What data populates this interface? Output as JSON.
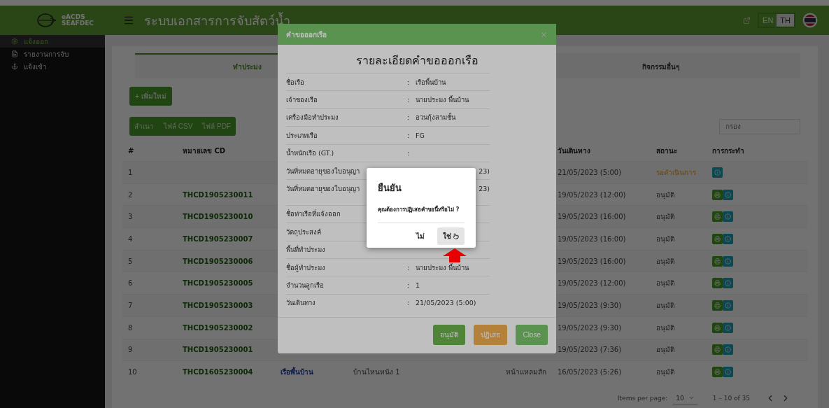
{
  "header": {
    "brand": [
      "eACDS",
      "SEAFDEC"
    ],
    "title": "ระบบเอกสารการจับสัตว์น้ำ",
    "languages": [
      {
        "label": "EN",
        "selected": false
      },
      {
        "label": "TH",
        "selected": true
      }
    ]
  },
  "sidebar": {
    "items": [
      {
        "label": "แจ้งออก",
        "kind": "gear",
        "selected": true
      },
      {
        "label": "รายงานการจับ",
        "kind": "file",
        "selected": false
      },
      {
        "label": "แจ้งเข้า",
        "kind": "anchor",
        "selected": false
      }
    ]
  },
  "tabs": [
    {
      "label": "ทำประมง",
      "selected": true
    },
    {
      "label": "กิจกรรมอื่นๆ",
      "selected": false
    }
  ],
  "add_button": "+ เพิ่มใหม่",
  "export_buttons": [
    "สำเนา",
    "ไฟล์ CSV",
    "ไฟล์ PDF"
  ],
  "filter": {
    "placeholder": "กรอง"
  },
  "table": {
    "columns": {
      "number": "#",
      "cd": "หมายเลข CD",
      "date": "วันเดินทาง",
      "status": "สถานะ",
      "actions": "การกระทำ"
    },
    "rows": [
      {
        "number": "1",
        "date": "21/05/2023 (5:00)",
        "status": "รอดำเนินการ",
        "pending": true,
        "printable": false
      },
      {
        "number": "2",
        "cd": "THCD1905230011",
        "date": "19/05/2023 (12:00)",
        "status": "อนุมัติ",
        "pending": false,
        "printable": true
      },
      {
        "number": "3",
        "cd": "THCD1905230010",
        "date": "19/05/2023 (16:00)",
        "status": "อนุมัติ",
        "pending": false,
        "printable": true
      },
      {
        "number": "4",
        "cd": "THCD1905230007",
        "date": "19/05/2023 (16:00)",
        "status": "อนุมัติ",
        "pending": false,
        "printable": true
      },
      {
        "number": "5",
        "cd": "THCD1905230006",
        "date": "19/05/2023 (16:00)",
        "status": "อนุมัติ",
        "pending": false,
        "printable": true
      },
      {
        "number": "6",
        "cd": "THCD1905230005",
        "date": "19/05/2023 (12:00)",
        "status": "อนุมัติ",
        "pending": false,
        "printable": true
      },
      {
        "number": "7",
        "cd": "THCD1905230003",
        "date": "19/05/2023 (9:30)",
        "status": "อนุมัติ",
        "pending": false,
        "printable": true
      },
      {
        "number": "8",
        "cd": "THCD1905230002",
        "date": "19/05/2023 (9:30)",
        "status": "อนุมัติ",
        "pending": false,
        "printable": true
      },
      {
        "number": "9",
        "cd": "THCD1905230001",
        "date": "19/05/2023 (7:36)",
        "status": "อนุมัติ",
        "pending": false,
        "printable": true
      },
      {
        "number": "10",
        "cd": "THCD1605230004",
        "column_3": "เรือพื้นบ้าน",
        "column_4": "บ้านไหนหนัง 1",
        "column_5": "หน้าแหลมสัก",
        "date": "16/05/2023 (5:26)",
        "status": "อนุมัติ",
        "pending": false,
        "printable": true
      }
    ]
  },
  "pagination": {
    "label": "Items per page:",
    "page_size": "10",
    "range": "1 – 10 of 35"
  },
  "modal": {
    "title": "คำขอออกเรือ",
    "heading": "รายละเอียดคำขอออกเรือ",
    "fields": [
      {
        "label": "ชื่อเรือ",
        "colon": ":",
        "value": "เรือพื้นบ้าน"
      },
      {
        "label": "เจ้าของเรือ",
        "colon": ":",
        "value": "นายประมง พื้นบ้าน"
      },
      {
        "label": "เครื่องมือทำประมง",
        "colon": ":",
        "value": "อวนกุ้งสามชั้น"
      },
      {
        "label": "ประเภทเรือ",
        "colon": ":",
        "value": "FG"
      },
      {
        "label": "น้ำหนักเรือ (GT.)",
        "colon": ":"
      },
      {
        "label": "วันที่หมดอายุของใบอนุญา",
        "value": "23)"
      },
      {
        "label": "วันที่หมดอายุของใบอนุญา",
        "value": "23)"
      },
      {
        "label": "ชื่อท่าเรือที่แจ้งออก",
        "gap": true
      },
      {
        "label": "วัตถุประสงค์"
      },
      {
        "label": "พื้นที่ทำประมง"
      },
      {
        "label": "ชื่อผู้ทำประมง",
        "colon": ":",
        "value": "นายประมง พื้นบ้าน"
      },
      {
        "label": "จำนวนลูกเรือ",
        "colon": ":",
        "value": "1"
      },
      {
        "label": "วันเดินทาง",
        "colon": ":",
        "value": "21/05/2023 (5:00)"
      }
    ],
    "buttons": [
      {
        "label": "อนุมัติ",
        "kind": "approve"
      },
      {
        "label": "ปฏิเสธ",
        "kind": "reject"
      },
      {
        "label": "Close",
        "kind": "close"
      }
    ]
  },
  "confirm": {
    "title": "ยืนยัน",
    "message": "คุณต้องการปฏิเสธคำขอนี้หรือไม่ ?",
    "buttons": [
      {
        "label": "ไม่",
        "selected": false
      },
      {
        "label": "ใช่",
        "selected": true
      }
    ]
  }
}
